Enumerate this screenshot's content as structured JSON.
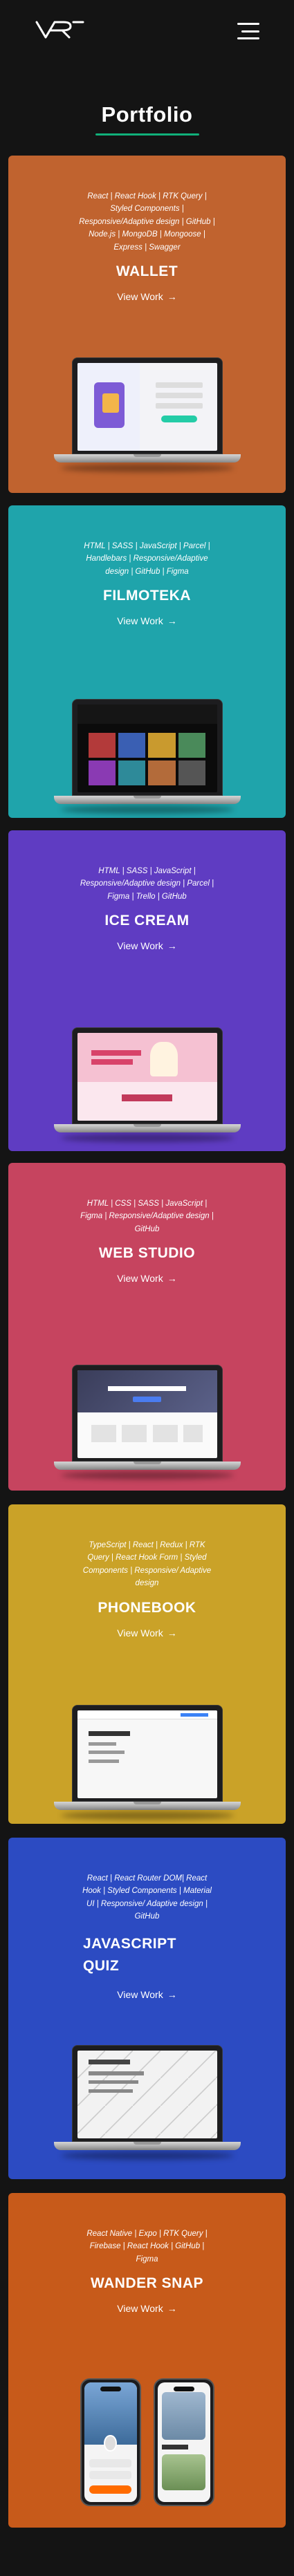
{
  "header": {
    "logo_icon": "vr-logo-icon",
    "menu_icon": "hamburger-menu-icon"
  },
  "page": {
    "title": "Portfolio",
    "accent": "#10b07a",
    "background": "#141414"
  },
  "projects": [
    {
      "name": "WALLET",
      "tech": "React | React Hook | RTK Query | Styled Components | Responsive/Adaptive design | GitHub | Node.js | MongoDB | Mongoose | Express | Swagger",
      "view_label": "View Work",
      "arrow": "→",
      "color": "#c0632f",
      "device": "laptop"
    },
    {
      "name": "FILMOTEKA",
      "tech": "HTML | SASS | JavaScript | Parcel | Handlebars | Responsive/Adaptive design | GitHub | Figma",
      "view_label": "View Work",
      "arrow": "→",
      "color": "#1fa4ab",
      "device": "laptop"
    },
    {
      "name": "ICE CREAM",
      "tech": "HTML | SASS | JavaScript | Responsive/Adaptive design | Parcel | Figma | Trello | GitHub",
      "view_label": "View Work",
      "arrow": "→",
      "color": "#5f3cc2",
      "device": "laptop"
    },
    {
      "name": "WEB STUDIO",
      "tech": "HTML | CSS | SASS | JavaScript | Figma | Responsive/Adaptive design | GitHub",
      "view_label": "View Work",
      "arrow": "→",
      "color": "#c6445f",
      "device": "laptop"
    },
    {
      "name": "PHONEBOOK",
      "tech": "TypeScript | React | Redux | RTK Query | React Hook Form | Styled Components | Responsive/ Adaptive design",
      "view_label": "View Work",
      "arrow": "→",
      "color": "#caa228",
      "device": "laptop"
    },
    {
      "name": "JAVASCRIPT QUIZ",
      "tech": "React | React Router DOM| React Hook | Styled Components | Material UI | Responsive/ Adaptive design | GitHub",
      "view_label": "View Work",
      "arrow": "→",
      "color": "#2c4bc2",
      "device": "laptop"
    },
    {
      "name": "WANDER SNAP",
      "tech": "React Native | Expo | RTK Query | Firebase | React Hook | GitHub | Figma",
      "view_label": "View Work",
      "arrow": "→",
      "color": "#c75a1a",
      "device": "phones"
    }
  ]
}
